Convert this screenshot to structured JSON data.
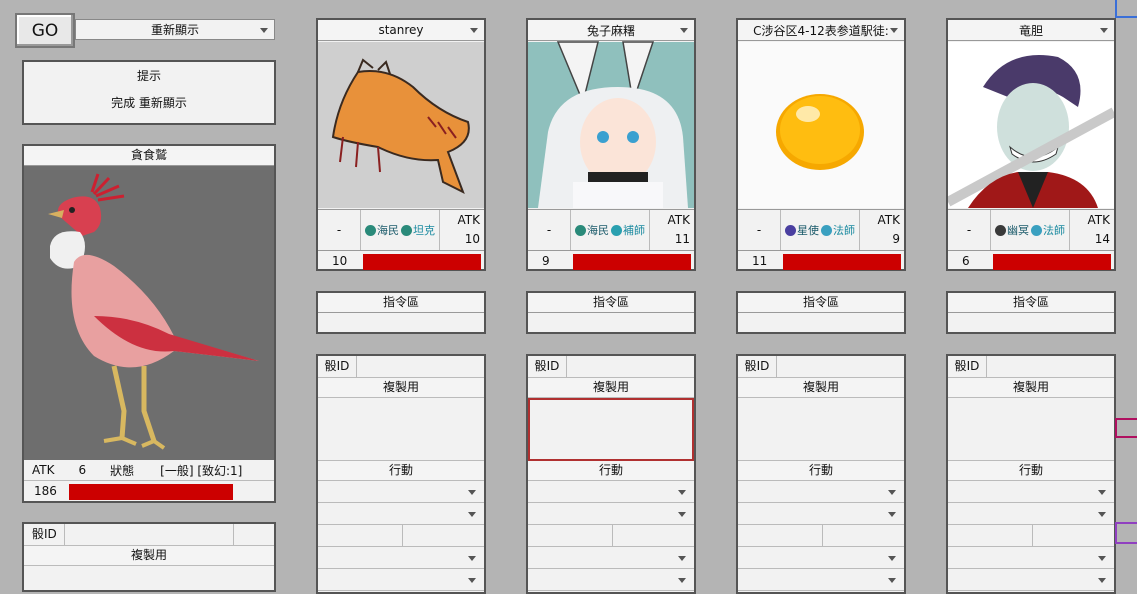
{
  "toolbar": {
    "go_label": "GO",
    "top_select": "重新顯示"
  },
  "hint": {
    "title": "提示",
    "message": "完成 重新顯示"
  },
  "main_unit": {
    "name": "貪食鷲",
    "atk_label": "ATK",
    "atk": "6",
    "status_label": "狀態",
    "status_value": "[一般] [致幻:1]",
    "hp": "186",
    "hp_fraction": 0.72
  },
  "left_panel": {
    "id_label": "骰ID",
    "copy_label": "複製用"
  },
  "cards": [
    {
      "name": "stanrey",
      "dash": "-",
      "tag1": "海民",
      "tag2": "坦克",
      "atk_label": "ATK",
      "atk": "10",
      "hp": "10",
      "hp_fraction": 1.0,
      "icon1_color": "#2a8a7a",
      "icon2_color": "#2a8a7a"
    },
    {
      "name": "兔子麻糬",
      "dash": "-",
      "tag1": "海民",
      "tag2": "補師",
      "atk_label": "ATK",
      "atk": "11",
      "hp": "9",
      "hp_fraction": 1.0,
      "icon1_color": "#2a8a7a",
      "icon2_color": "#2aa0b0"
    },
    {
      "name": "C涉谷区4-12表参道駅徒:",
      "dash": "-",
      "tag1": "星使",
      "tag2": "法師",
      "atk_label": "ATK",
      "atk": "9",
      "hp": "11",
      "hp_fraction": 1.0,
      "icon1_color": "#4a3fa0",
      "icon2_color": "#3aa0c0"
    },
    {
      "name": "竜胆",
      "dash": "-",
      "tag1": "幽冥",
      "tag2": "法師",
      "atk_label": "ATK",
      "atk": "14",
      "hp": "6",
      "hp_fraction": 1.0,
      "icon1_color": "#3a3a3a",
      "icon2_color": "#3aa0c0"
    }
  ],
  "command": {
    "label": "指令區"
  },
  "panel": {
    "id_label": "骰ID",
    "copy_label": "複製用",
    "action_label": "行動"
  }
}
